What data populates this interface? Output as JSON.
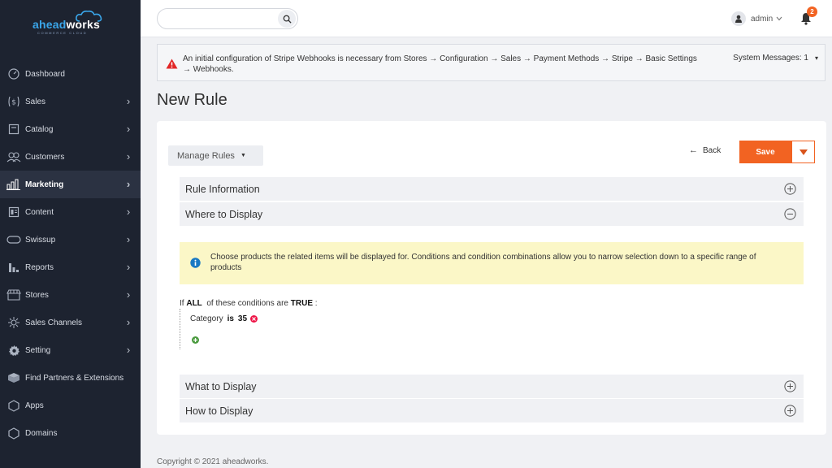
{
  "brand": {
    "name_part1": "ahead",
    "name_part2": "works",
    "tagline": "COMMERCE CLOUD"
  },
  "sidebar": {
    "items": [
      {
        "label": "Dashboard",
        "icon": "dashboard-icon",
        "chevron": false
      },
      {
        "label": "Sales",
        "icon": "dollar-icon",
        "chevron": true
      },
      {
        "label": "Catalog",
        "icon": "catalog-icon",
        "chevron": true
      },
      {
        "label": "Customers",
        "icon": "customers-icon",
        "chevron": true
      },
      {
        "label": "Marketing",
        "icon": "marketing-icon",
        "chevron": true,
        "active": true
      },
      {
        "label": "Content",
        "icon": "content-icon",
        "chevron": true
      },
      {
        "label": "Swissup",
        "icon": "swissup-icon",
        "chevron": true
      },
      {
        "label": "Reports",
        "icon": "reports-icon",
        "chevron": true
      },
      {
        "label": "Stores",
        "icon": "stores-icon",
        "chevron": true
      },
      {
        "label": "Sales Channels",
        "icon": "sales-channels-icon",
        "chevron": true
      },
      {
        "label": "Setting",
        "icon": "gear-icon",
        "chevron": true
      },
      {
        "label": "Find Partners & Extensions",
        "icon": "partners-icon",
        "chevron": false
      },
      {
        "label": "Apps",
        "icon": "hexagon-icon",
        "chevron": false
      },
      {
        "label": "Domains",
        "icon": "hexagon-icon",
        "chevron": false
      }
    ]
  },
  "header": {
    "search": {
      "value": "",
      "placeholder": ""
    },
    "user": {
      "name": "admin"
    },
    "notifications": {
      "count": "2"
    }
  },
  "message": {
    "text": "An initial configuration of Stripe Webhooks is necessary from Stores → Configuration → Sales → Payment Methods → Stripe → Basic Settings → Webhooks.",
    "system": "System Messages: 1"
  },
  "page": {
    "title": "New Rule"
  },
  "toolbar": {
    "manage_rules": "Manage Rules",
    "back": "Back",
    "save": "Save"
  },
  "sections": {
    "rule_information": "Rule Information",
    "where_to_display": "Where to Display",
    "what_to_display": "What to Display",
    "how_to_display": "How to Display"
  },
  "info": {
    "text": "Choose products the related items will be displayed for. Conditions and condition combinations allow you to narrow selection down to a specific range of products"
  },
  "conditions": {
    "prefix": "If",
    "aggregator": "ALL",
    "middle": "of these conditions are",
    "value": "TRUE",
    "suffix": ":",
    "rule": {
      "attribute": "Category",
      "operator": "is",
      "value": "35"
    }
  },
  "footer": {
    "copyright": "Copyright © 2021 aheadworks."
  },
  "colors": {
    "accent": "#f26322",
    "sidebar": "#1d2330",
    "info_bg": "#fbf7c7"
  }
}
